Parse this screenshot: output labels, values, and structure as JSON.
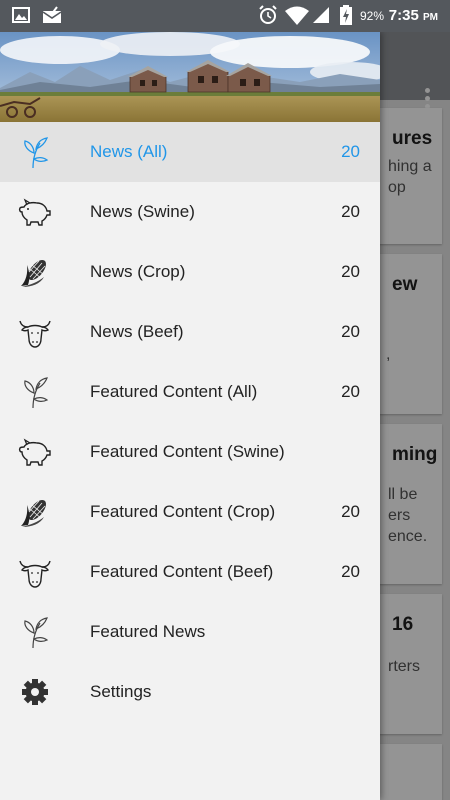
{
  "status_bar": {
    "battery_percent": "92%",
    "time": "7:35",
    "time_suffix": "PM"
  },
  "background_cards": [
    {
      "title": "ures",
      "lines": [
        "hing a",
        "op"
      ]
    },
    {
      "title": "ew",
      "lines": [
        "",
        ","
      ]
    },
    {
      "title": "ming",
      "lines": [
        "ll be",
        "ers",
        "ence."
      ]
    },
    {
      "title": "16",
      "lines": [
        "rters"
      ]
    },
    {
      "title": "",
      "lines": []
    }
  ],
  "drawer": {
    "items": [
      {
        "label": "News (All)",
        "count": "20",
        "icon": "sprout-icon",
        "active": true
      },
      {
        "label": "News (Swine)",
        "count": "20",
        "icon": "pig-icon",
        "active": false
      },
      {
        "label": "News (Crop)",
        "count": "20",
        "icon": "corn-icon",
        "active": false
      },
      {
        "label": "News (Beef)",
        "count": "20",
        "icon": "cow-icon",
        "active": false
      },
      {
        "label": "Featured Content (All)",
        "count": "20",
        "icon": "sprout-icon",
        "active": false
      },
      {
        "label": "Featured Content (Swine)",
        "count": "",
        "icon": "pig-icon",
        "active": false
      },
      {
        "label": "Featured Content (Crop)",
        "count": "20",
        "icon": "corn-icon",
        "active": false
      },
      {
        "label": "Featured Content (Beef)",
        "count": "20",
        "icon": "cow-icon",
        "active": false
      },
      {
        "label": "Featured News",
        "count": "",
        "icon": "sprout-icon",
        "active": false
      },
      {
        "label": "Settings",
        "count": "",
        "icon": "gear-icon",
        "active": false
      }
    ]
  },
  "colors": {
    "accent": "#2196e8",
    "status_bar": "#54585d",
    "drawer_bg": "#f2f2f2",
    "active_row": "#e2e2e2"
  }
}
